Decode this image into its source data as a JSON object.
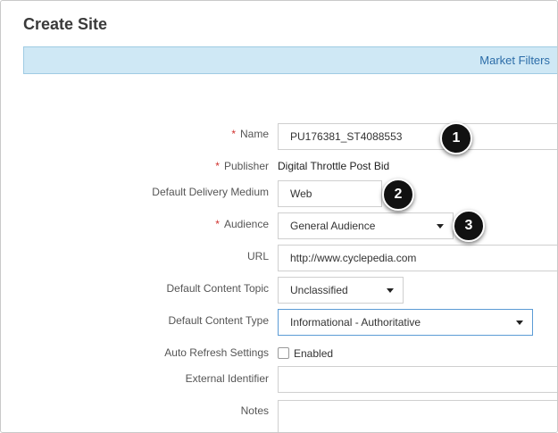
{
  "page": {
    "title": "Create Site"
  },
  "filter_bar": {
    "link": "Market Filters"
  },
  "form": {
    "required_mark": "*",
    "name": {
      "label": "Name",
      "value": "PU176381_ST4088553"
    },
    "publisher": {
      "label": "Publisher",
      "value": "Digital Throttle Post Bid"
    },
    "delivery_medium": {
      "label": "Default Delivery Medium",
      "value": "Web"
    },
    "audience": {
      "label": "Audience",
      "value": "General Audience"
    },
    "url": {
      "label": "URL",
      "value": "http://www.cyclepedia.com"
    },
    "content_topic": {
      "label": "Default Content Topic",
      "value": "Unclassified"
    },
    "content_type": {
      "label": "Default Content Type",
      "value": "Informational - Authoritative"
    },
    "auto_refresh": {
      "label": "Auto Refresh Settings",
      "checkbox_label": "Enabled",
      "checked": false
    },
    "external_identifier": {
      "label": "External Identifier",
      "value": ""
    },
    "notes": {
      "label": "Notes",
      "value": ""
    }
  },
  "callouts": [
    "1",
    "2",
    "3"
  ]
}
